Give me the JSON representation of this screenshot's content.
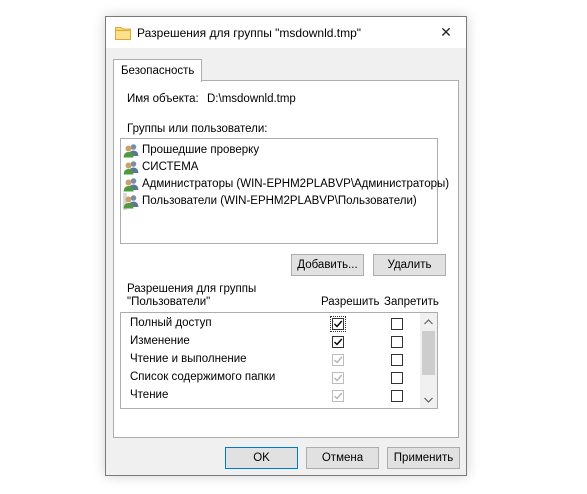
{
  "window": {
    "title": "Разрешения для группы \"msdownld.tmp\"",
    "close_glyph": "✕"
  },
  "tab": {
    "label": "Безопасность"
  },
  "object": {
    "label": "Имя объекта:",
    "value": "D:\\msdownld.tmp"
  },
  "groups": {
    "label": "Группы или пользователи:",
    "items": [
      {
        "name": "Прошедшие проверку",
        "icon": "users-icon",
        "selected": false
      },
      {
        "name": "СИСТЕМА",
        "icon": "users-icon",
        "selected": false
      },
      {
        "name": "Администраторы (WIN-EPHM2PLABVP\\Администраторы)",
        "icon": "users-icon",
        "selected": false
      },
      {
        "name": "Пользователи (WIN-EPHM2PLABVP\\Пользователи)",
        "icon": "users-icon",
        "selected": true
      }
    ]
  },
  "buttons": {
    "add": "Добавить...",
    "remove": "Удалить",
    "ok": "OK",
    "cancel": "Отмена",
    "apply": "Применить"
  },
  "permissions": {
    "label_line1": "Разрешения для группы",
    "label_line2": "\"Пользователи\"",
    "allow_header": "Разрешить",
    "deny_header": "Запретить",
    "rows": [
      {
        "name": "Полный доступ",
        "allow": true,
        "allow_inherited": false,
        "deny": false
      },
      {
        "name": "Изменение",
        "allow": true,
        "allow_inherited": false,
        "deny": false
      },
      {
        "name": "Чтение и выполнение",
        "allow": true,
        "allow_inherited": true,
        "deny": false
      },
      {
        "name": "Список содержимого папки",
        "allow": true,
        "allow_inherited": true,
        "deny": false
      },
      {
        "name": "Чтение",
        "allow": true,
        "allow_inherited": true,
        "deny": false
      },
      {
        "name": "",
        "allow": true,
        "allow_inherited": true,
        "deny": false
      }
    ]
  },
  "colors": {
    "accent": "#0078d7",
    "selection": "#d9d9d9",
    "inherited_check": "#b4b4b4"
  }
}
